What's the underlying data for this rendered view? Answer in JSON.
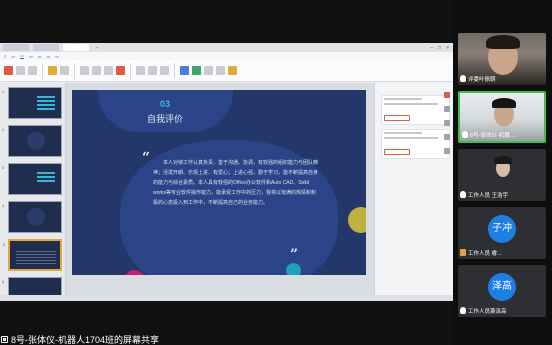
{
  "app": {
    "window_tabs": [
      "",
      "",
      ""
    ]
  },
  "slide": {
    "number": "03",
    "heading": "自我评价",
    "open_quote": "“",
    "close_quote": "”",
    "body": "本人对待工作认真负责，善于沟通、协调，有较强的组织能力与团队精神；活泼开朗、乐观上进、有爱心；上进心强，勤于学习，能不断提高自身的能力与综合素质。本人具有较强的Office办公软件和Auto CAD、Solid works等专业软件操作能力，能承受工作中的压力，我将以饱满的热情和积极的心态投入到工作中，不断提高自己的业务能力。"
  },
  "participants": [
    {
      "label": "评委叶振朝",
      "type": "video",
      "muted_icon": "mic-icon"
    },
    {
      "label": "8号-张体仪-机器...",
      "type": "video",
      "muted_icon": "mic-icon"
    },
    {
      "label": "工作人员 王浩宇",
      "type": "video",
      "muted_icon": "mic-icon"
    },
    {
      "label": "工作人员 睿...",
      "type": "avatar",
      "avatar_text": "子冲",
      "muted_icon": "person-icon"
    },
    {
      "label": "工作人员萧泽高",
      "type": "avatar",
      "avatar_text": "泽高",
      "muted_icon": "mic-icon"
    }
  ],
  "bottom": {
    "share_label": "8号-张体仪-机器人1704班的屏幕共享"
  },
  "colors": {
    "slide_bg": "#23376b",
    "accent_cyan": "#3ab7e6",
    "active_speaker": "#3fbf4a",
    "avatar_blue": "#1d7fe3"
  }
}
